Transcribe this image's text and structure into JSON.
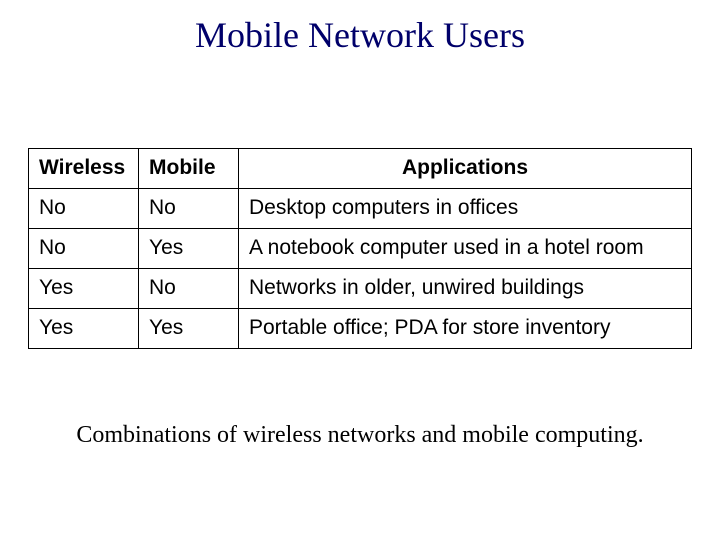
{
  "title": "Mobile Network Users",
  "table": {
    "headers": [
      "Wireless",
      "Mobile",
      "Applications"
    ],
    "rows": [
      {
        "wireless": "No",
        "mobile": "No",
        "app": "Desktop computers in offices"
      },
      {
        "wireless": "No",
        "mobile": "Yes",
        "app": "A notebook computer used in a hotel room"
      },
      {
        "wireless": "Yes",
        "mobile": "No",
        "app": "Networks in older, unwired buildings"
      },
      {
        "wireless": "Yes",
        "mobile": "Yes",
        "app": "Portable office; PDA for store inventory"
      }
    ]
  },
  "caption": "Combinations of wireless networks and mobile computing."
}
